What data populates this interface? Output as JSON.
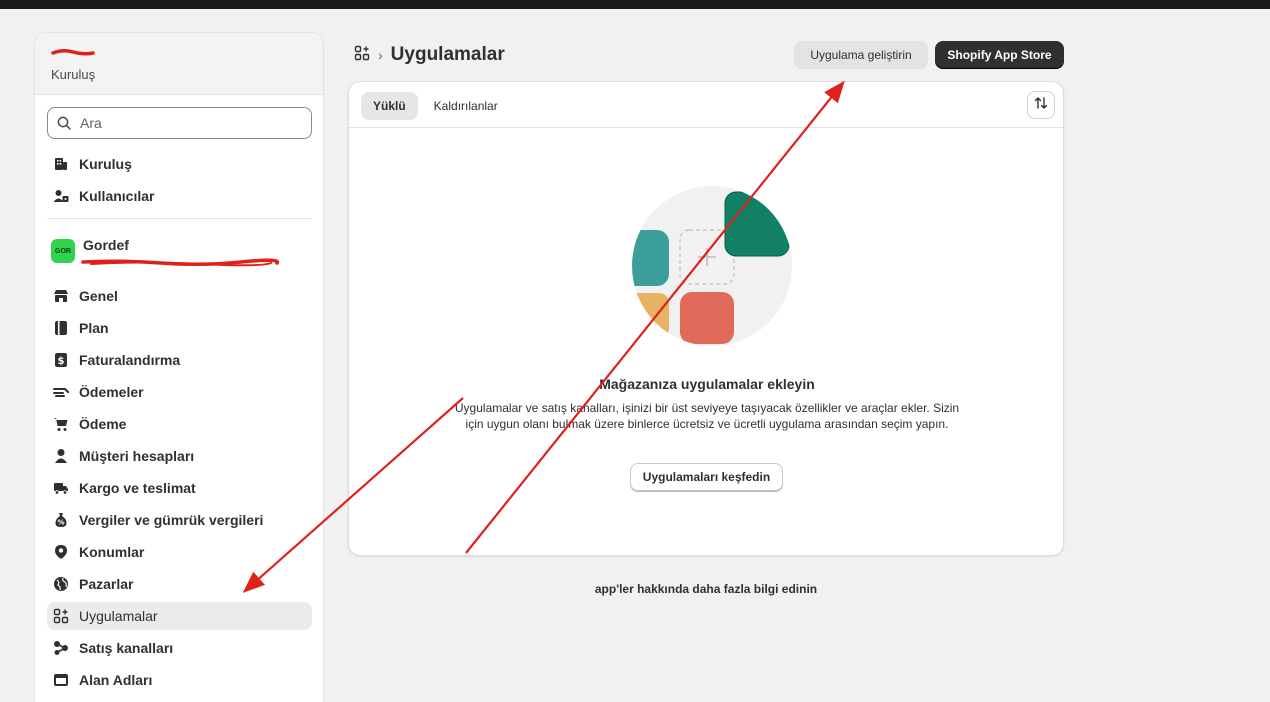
{
  "sidebar": {
    "store_name": "",
    "store_sub": "Kuruluş",
    "search": {
      "placeholder": "Ara"
    },
    "top_items": [
      {
        "label": "Kuruluş",
        "icon": "building-icon"
      },
      {
        "label": "Kullanıcılar",
        "icon": "users-icon"
      }
    ],
    "store": {
      "avatar_text": "GOR",
      "title": "Gordef",
      "subtitle": ""
    },
    "items": [
      {
        "label": "Genel",
        "icon": "store-icon"
      },
      {
        "label": "Plan",
        "icon": "plan-icon"
      },
      {
        "label": "Faturalandırma",
        "icon": "invoice-icon"
      },
      {
        "label": "Ödemeler",
        "icon": "payments-icon"
      },
      {
        "label": "Ödeme",
        "icon": "cart-icon"
      },
      {
        "label": "Müşteri hesapları",
        "icon": "person-icon"
      },
      {
        "label": "Kargo ve teslimat",
        "icon": "truck-icon"
      },
      {
        "label": "Vergiler ve gümrük vergileri",
        "icon": "tax-icon"
      },
      {
        "label": "Konumlar",
        "icon": "location-icon"
      },
      {
        "label": "Pazarlar",
        "icon": "globe-icon"
      },
      {
        "label": "Uygulamalar",
        "icon": "apps-icon",
        "active": true
      },
      {
        "label": "Satış kanalları",
        "icon": "channels-icon"
      },
      {
        "label": "Alan Adları",
        "icon": "domain-icon"
      }
    ]
  },
  "header": {
    "title": "Uygulamalar",
    "separator": "›",
    "develop_button": "Uygulama geliştirin",
    "store_button": "Shopify App Store"
  },
  "card": {
    "tabs": [
      {
        "label": "Yüklü",
        "selected": true
      },
      {
        "label": "Kaldırılanlar",
        "selected": false
      }
    ],
    "empty_title": "Mağazanıza uygulamalar ekleyin",
    "empty_text": "Uygulamalar ve satış kanalları, işinizi bir üst seviyeye taşıyacak özellikler ve araçlar ekler. Sizin için uygun olanı bulmak üzere binlerce ücretsiz ve ücretli uygulama arasından seçim yapın.",
    "explore_button": "Uygulamaları keşfedin"
  },
  "footer": {
    "learn_more": "app'ler hakkında daha fazla bilgi edinin"
  },
  "colors": {
    "accent_dark": "#303030",
    "annotation_red": "#e0201b",
    "avatar_green": "#30d34a",
    "tile_green": "#128064",
    "tile_teal": "#3c9e9a",
    "tile_red": "#e0695a",
    "tile_orange": "#e8b265"
  }
}
